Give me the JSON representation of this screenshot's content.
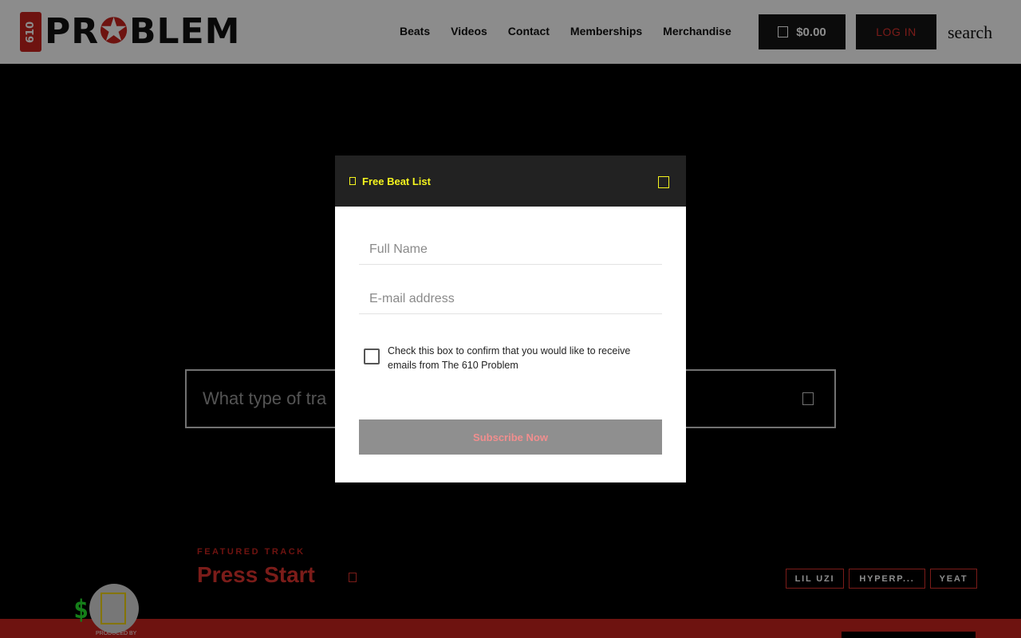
{
  "header": {
    "logo": {
      "badge": "610",
      "text_pre": "PR",
      "text_mark": "✪",
      "text_post": "BLEM"
    },
    "nav": [
      "Beats",
      "Videos",
      "Contact",
      "Memberships",
      "Merchandise"
    ],
    "cart_total": "$0.00",
    "login_label": "LOG IN",
    "search_label": "search"
  },
  "main": {
    "search_placeholder": "What type of tra",
    "featured": {
      "label": "FEATURED TRACK",
      "title": "Press Start",
      "tags": [
        "LIL UZI",
        "HYPERP...",
        "YEAT"
      ]
    },
    "producer": {
      "letters": "$$",
      "caption": "PRODUCED BY"
    }
  },
  "modal": {
    "title": "Free Beat List",
    "name_placeholder": "Full Name",
    "email_placeholder": "E-mail address",
    "consent_text": "Check this box to confirm that you would like to receive emails from The 610 Problem",
    "subscribe_label": "Subscribe Now"
  },
  "colors": {
    "brand_red": "#c8231e",
    "modal_header": "#222222",
    "accent_yellow": "#f5f51e",
    "button_gray": "#8f8f8f"
  }
}
